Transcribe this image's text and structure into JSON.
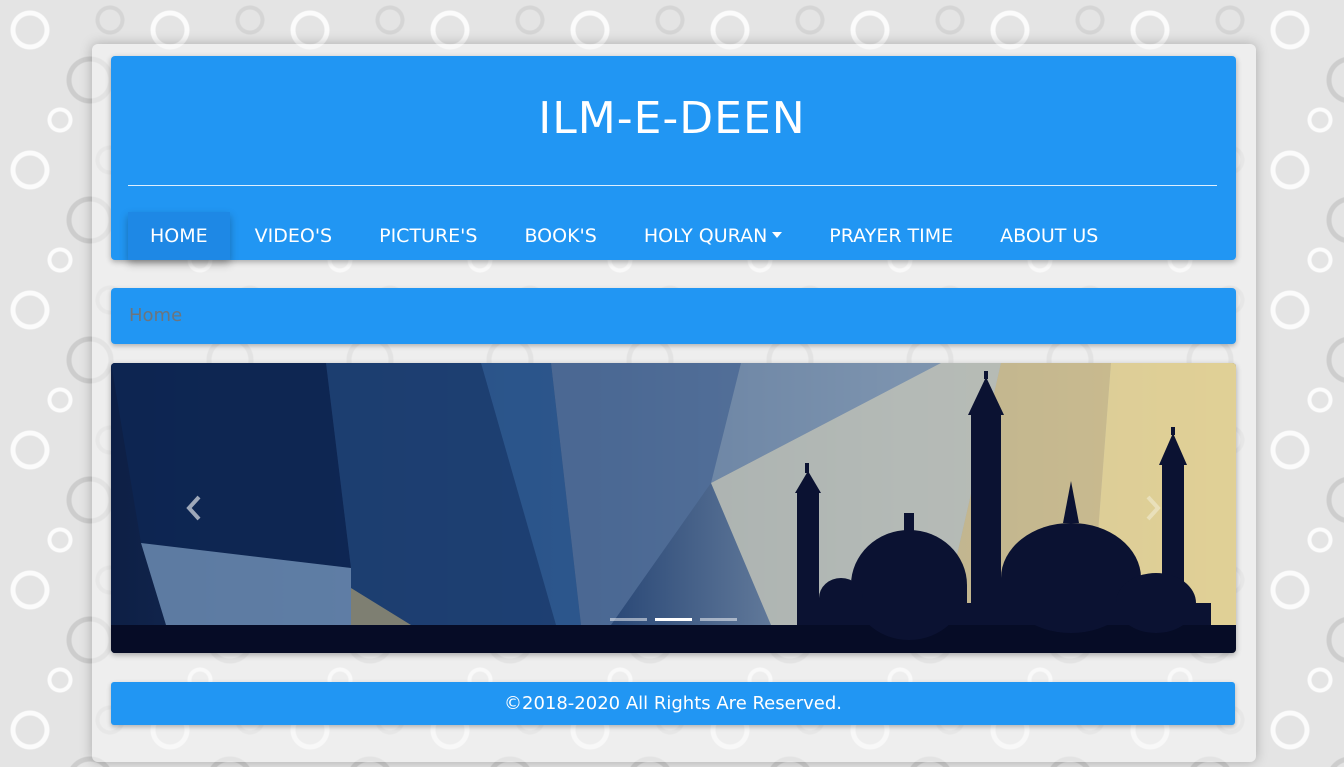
{
  "site": {
    "title": "ILM-E-DEEN"
  },
  "nav": {
    "items": [
      {
        "label": "HOME",
        "active": true
      },
      {
        "label": "VIDEO'S",
        "active": false
      },
      {
        "label": "PICTURE'S",
        "active": false
      },
      {
        "label": "BOOK'S",
        "active": false
      },
      {
        "label": "HOLY QURAN",
        "active": false,
        "dropdown": true
      },
      {
        "label": "PRAYER TIME",
        "active": false
      },
      {
        "label": "ABOUT US",
        "active": false
      }
    ]
  },
  "breadcrumb": {
    "current": "Home"
  },
  "carousel": {
    "prev_icon": "chevron-left-icon",
    "next_icon": "chevron-right-icon",
    "slide_count": 3,
    "active_slide": 2
  },
  "footer": {
    "text": "©2018-2020 All Rights Are Reserved."
  },
  "colors": {
    "primary": "#2196f3",
    "background": "#e4e4e4",
    "breadcrumb_text": "#6c757d",
    "mosque_silhouette": "#0b1232"
  }
}
